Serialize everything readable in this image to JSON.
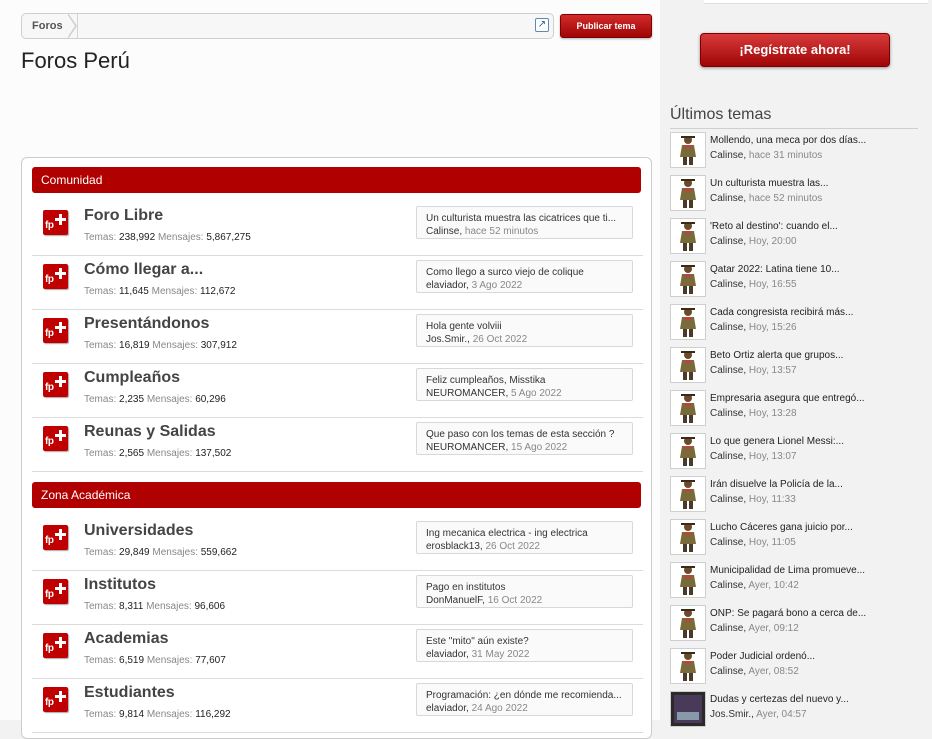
{
  "breadcrumb": {
    "root": "Foros"
  },
  "actions": {
    "post_thread": "Publicar tema"
  },
  "page": {
    "title": "Foros Perú"
  },
  "categories": [
    {
      "name": "Comunidad",
      "forums": [
        {
          "name": "Foro Libre",
          "threads_label": "Temas:",
          "threads": "238,992",
          "messages_label": "Mensajes:",
          "messages": "5,867,275",
          "last_title": "Un culturista muestra las cicatrices que ti...",
          "last_user": "Calinse",
          "last_time": "hace 52 minutos"
        },
        {
          "name": "Cómo llegar a...",
          "threads_label": "Temas:",
          "threads": "11,645",
          "messages_label": "Mensajes:",
          "messages": "112,672",
          "last_title": "Como llego a surco viejo de colique",
          "last_user": "elaviador",
          "last_time": "3 Ago 2022"
        },
        {
          "name": "Presentándonos",
          "threads_label": "Temas:",
          "threads": "16,819",
          "messages_label": "Mensajes:",
          "messages": "307,912",
          "last_title": "Hola gente volviii",
          "last_user": "Jos.Smir.",
          "last_time": "26 Oct 2022"
        },
        {
          "name": "Cumpleaños",
          "threads_label": "Temas:",
          "threads": "2,235",
          "messages_label": "Mensajes:",
          "messages": "60,296",
          "last_title": "Feliz cumpleaños, Misstika",
          "last_user": "NEUROMANCER",
          "last_time": "5 Ago 2022"
        },
        {
          "name": "Reunas y Salidas",
          "threads_label": "Temas:",
          "threads": "2,565",
          "messages_label": "Mensajes:",
          "messages": "137,502",
          "last_title": "Que paso con los temas de esta sección ?",
          "last_user": "NEUROMANCER",
          "last_time": "15 Ago 2022"
        }
      ]
    },
    {
      "name": "Zona Académica",
      "forums": [
        {
          "name": "Universidades",
          "threads_label": "Temas:",
          "threads": "29,849",
          "messages_label": "Mensajes:",
          "messages": "559,662",
          "last_title": "Ing mecanica electrica - ing electrica",
          "last_user": "erosblack13",
          "last_time": "26 Oct 2022"
        },
        {
          "name": "Institutos",
          "threads_label": "Temas:",
          "threads": "8,311",
          "messages_label": "Mensajes:",
          "messages": "96,606",
          "last_title": "Pago en institutos",
          "last_user": "DonManuelF",
          "last_time": "16 Oct 2022"
        },
        {
          "name": "Academias",
          "threads_label": "Temas:",
          "threads": "6,519",
          "messages_label": "Mensajes:",
          "messages": "77,607",
          "last_title": "Este \"mito\" aún existe?",
          "last_user": "elaviador",
          "last_time": "31 May 2022"
        },
        {
          "name": "Estudiantes",
          "threads_label": "Temas:",
          "threads": "9,814",
          "messages_label": "Mensajes:",
          "messages": "116,292",
          "last_title": "Programación: ¿en dónde me recomienda...",
          "last_user": "elaviador",
          "last_time": "24 Ago 2022"
        }
      ]
    }
  ],
  "sidebar": {
    "register_label": "¡Regístrate ahora!",
    "latest_title": "Últimos temas",
    "threads": [
      {
        "title": "Mollendo, una meca por dos días...",
        "user": "Calinse",
        "time": "hace 31 minutos"
      },
      {
        "title": "Un culturista muestra las...",
        "user": "Calinse",
        "time": "hace 52 minutos"
      },
      {
        "title": "'Reto al destino': cuando el...",
        "user": "Calinse",
        "time": "Hoy, 20:00"
      },
      {
        "title": "Qatar 2022: Latina tiene 10...",
        "user": "Calinse",
        "time": "Hoy, 16:55"
      },
      {
        "title": "Cada congresista recibirá más...",
        "user": "Calinse",
        "time": "Hoy, 15:26"
      },
      {
        "title": "Beto Ortiz alerta que grupos...",
        "user": "Calinse",
        "time": "Hoy, 13:57"
      },
      {
        "title": "Empresaria asegura que entregó...",
        "user": "Calinse",
        "time": "Hoy, 13:28"
      },
      {
        "title": "Lo que genera Lionel Messi:...",
        "user": "Calinse",
        "time": "Hoy, 13:07"
      },
      {
        "title": "Irán disuelve la Policía de la...",
        "user": "Calinse",
        "time": "Hoy, 11:33"
      },
      {
        "title": "Lucho Cáceres gana juicio por...",
        "user": "Calinse",
        "time": "Hoy, 11:05"
      },
      {
        "title": "Municipalidad de Lima promueve...",
        "user": "Calinse",
        "time": "Ayer, 10:42"
      },
      {
        "title": "ONP: Se pagará bono a cerca de...",
        "user": "Calinse",
        "time": "Ayer, 09:12"
      },
      {
        "title": "Poder Judicial ordenó...",
        "user": "Calinse",
        "time": "Ayer, 08:52"
      },
      {
        "title": "Dudas y certezas del nuevo y...",
        "user": "Jos.Smir.",
        "time": "Ayer, 04:57"
      }
    ]
  }
}
